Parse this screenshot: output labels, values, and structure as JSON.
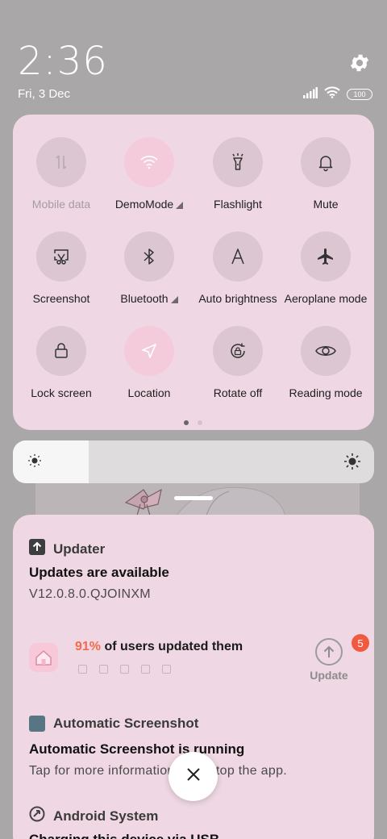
{
  "status_bar": {
    "time": "2:36",
    "date": "Fri, 3 Dec",
    "battery": "100",
    "icons": [
      "signal-icon",
      "wifi-icon",
      "battery-icon"
    ]
  },
  "header": {
    "settings_icon": "gear-icon"
  },
  "quick_settings": {
    "tiles": [
      {
        "label": "Mobile data",
        "icon": "mobile-data-icon",
        "active": false,
        "disabled": true
      },
      {
        "label": "DemoMode",
        "icon": "wifi-icon",
        "active": true,
        "has_caret": true
      },
      {
        "label": "Flashlight",
        "icon": "flashlight-icon",
        "active": false
      },
      {
        "label": "Mute",
        "icon": "bell-icon",
        "active": false
      },
      {
        "label": "Screenshot",
        "icon": "screenshot-icon",
        "active": false
      },
      {
        "label": "Bluetooth",
        "icon": "bluetooth-icon",
        "active": false,
        "has_caret": true
      },
      {
        "label": "Auto brightness",
        "icon": "auto-brightness-icon",
        "active": false
      },
      {
        "label": "Aeroplane mode",
        "icon": "airplane-icon",
        "active": false
      },
      {
        "label": "Lock screen",
        "icon": "lock-icon",
        "active": false
      },
      {
        "label": "Location",
        "icon": "location-icon",
        "active": true
      },
      {
        "label": "Rotate off",
        "icon": "rotate-lock-icon",
        "active": false
      },
      {
        "label": "Reading mode",
        "icon": "eye-icon",
        "active": false
      }
    ],
    "pages": 2,
    "current_page": 1
  },
  "brightness": {
    "level": 0.21
  },
  "notifications": {
    "updater": {
      "app_name": "Updater",
      "title": "Updates are available",
      "version": "V12.0.8.0.QJOINXM",
      "percent": "91%",
      "percent_text": "of users updated them",
      "button_label": "Update",
      "badge_count": "5"
    },
    "screenshot": {
      "app_name": "Automatic Screenshot",
      "title": "Automatic Screenshot is running",
      "subtitle": "Tap for more information or to stop the app."
    },
    "android": {
      "app_name": "Android System",
      "title": "Charging this device via USB"
    }
  },
  "colors": {
    "panel": "#efd8e3",
    "tile_off": "#dcc6d1",
    "tile_on": "#f4cbdb",
    "accent_orange": "#f26b4a",
    "badge": "#f05a40"
  }
}
